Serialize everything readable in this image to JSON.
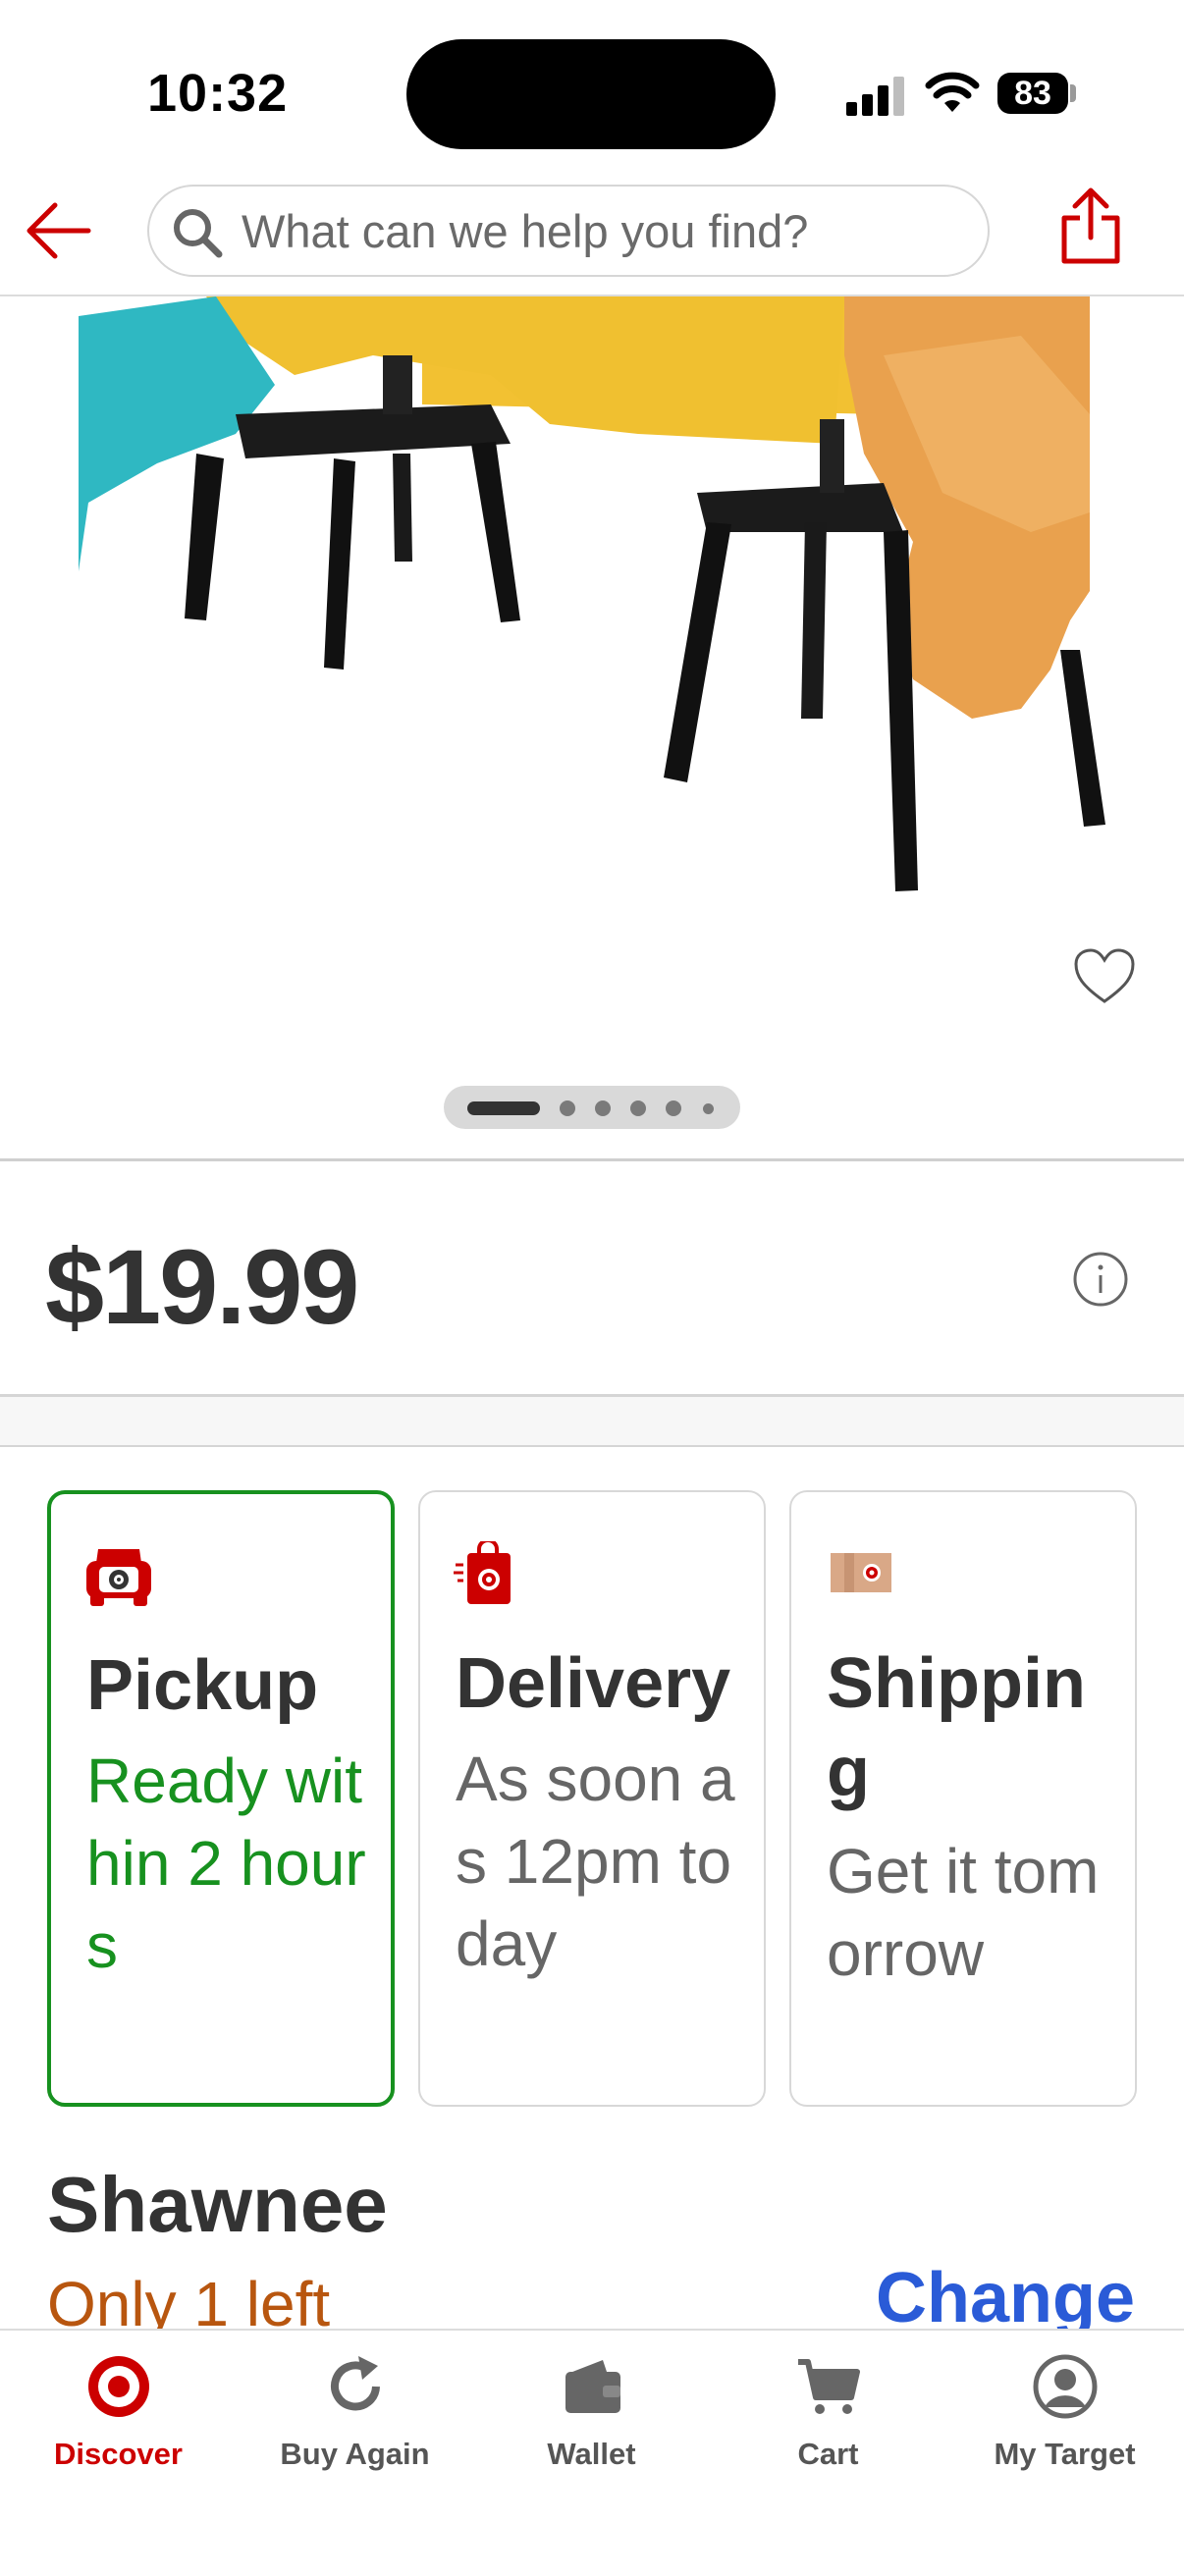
{
  "status_bar": {
    "time": "10:32",
    "battery": "83"
  },
  "header": {
    "search_placeholder": "What can we help you find?"
  },
  "product": {
    "price": "$19.99",
    "carousel_total_images": 6,
    "carousel_active_index": 1
  },
  "fulfillment": [
    {
      "title": "Pickup",
      "subtitle": "Ready within 2 hours",
      "selected": true
    },
    {
      "title": "Delivery",
      "subtitle": "As soon as 12pm today",
      "selected": false
    },
    {
      "title": "Shipping",
      "subtitle": "Get it tomorrow",
      "selected": false
    }
  ],
  "store": {
    "name": "Shawnee",
    "stock": "Only 1 left",
    "change_label": "Change"
  },
  "tabbar": [
    {
      "label": "Discover",
      "active": true
    },
    {
      "label": "Buy Again",
      "active": false
    },
    {
      "label": "Wallet",
      "active": false
    },
    {
      "label": "Cart",
      "active": false
    },
    {
      "label": "My Target",
      "active": false
    }
  ],
  "colors": {
    "brand_red": "#cc0000",
    "pickup_green": "#17911f",
    "link_blue": "#2a5bd7",
    "stock_orange": "#b8560f"
  }
}
